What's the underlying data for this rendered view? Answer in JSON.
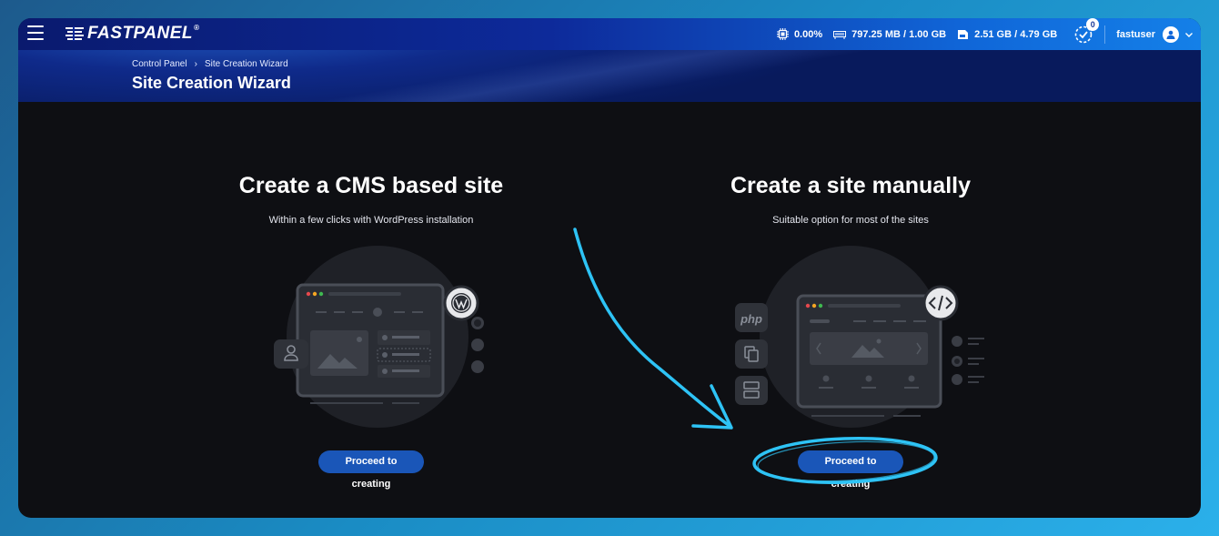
{
  "brand": {
    "name": "FASTPANEL",
    "reg": "®"
  },
  "stats": {
    "cpu": "0.00%",
    "memory": "797.25 MB / 1.00 GB",
    "disk": "2.51 GB / 4.79 GB",
    "tasks_count": "0"
  },
  "user": {
    "name": "fastuser"
  },
  "breadcrumb": {
    "root": "Control Panel",
    "current": "Site Creation Wizard"
  },
  "page_title": "Site Creation Wizard",
  "options": [
    {
      "title": "Create a CMS based site",
      "subtitle": "Within a few clicks with WordPress installation",
      "button": "Proceed to creating"
    },
    {
      "title": "Create a site manually",
      "subtitle": "Suitable option for most of the sites",
      "button": "Proceed to creating"
    }
  ],
  "illustration": {
    "php_label": "php"
  },
  "colors": {
    "accent": "#1a56b8",
    "annotation": "#2ec3f5",
    "background": "#0e0f13"
  }
}
